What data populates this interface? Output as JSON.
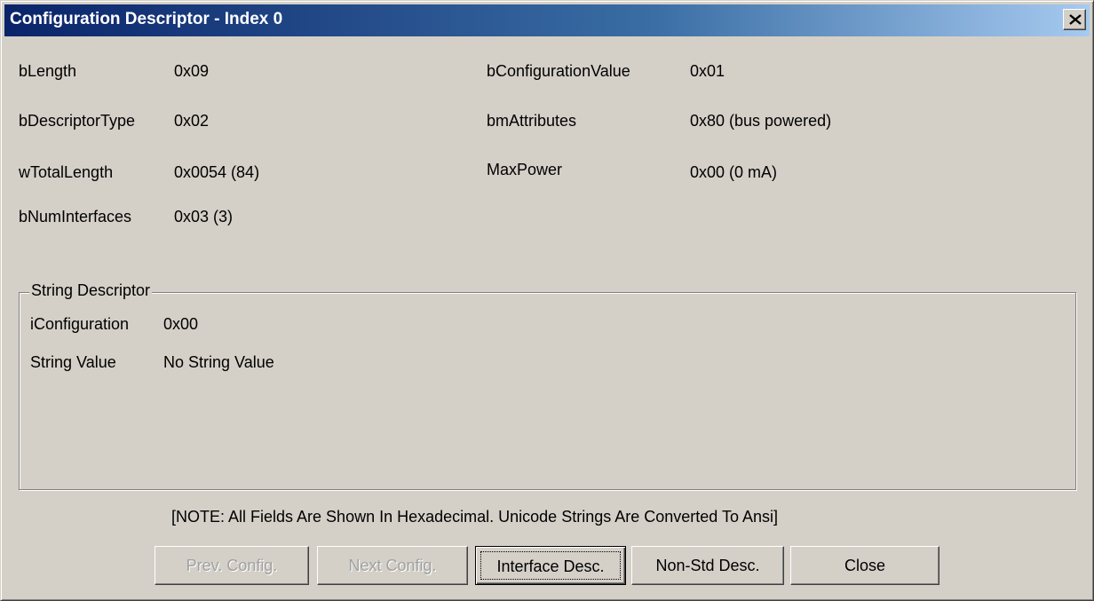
{
  "window": {
    "title": "Configuration Descriptor - Index 0",
    "close_icon": "close-x-icon"
  },
  "fields_left": [
    {
      "label": "bLength",
      "value": "0x09"
    },
    {
      "label": "bDescriptorType",
      "value": "0x02"
    },
    {
      "label": "wTotalLength",
      "value": "0x0054 (84)"
    },
    {
      "label": "bNumInterfaces",
      "value": "0x03 (3)"
    }
  ],
  "fields_right": [
    {
      "label": "bConfigurationValue",
      "value": "0x01"
    },
    {
      "label": "bmAttributes",
      "value": "0x80 (bus powered)"
    },
    {
      "label": "MaxPower",
      "value": "0x00 (0 mA)"
    }
  ],
  "string_descriptor": {
    "legend": "String Descriptor",
    "rows": [
      {
        "label": "iConfiguration",
        "value": "0x00"
      },
      {
        "label": "String Value",
        "value": "No String Value"
      }
    ]
  },
  "note": "[NOTE: All Fields Are Shown In Hexadecimal.   Unicode Strings Are Converted To Ansi]",
  "buttons": {
    "prev_config": "Prev. Config.",
    "next_config": "Next Config.",
    "interface_desc": "Interface Desc.",
    "non_std_desc": "Non-Std Desc.",
    "close": "Close"
  }
}
